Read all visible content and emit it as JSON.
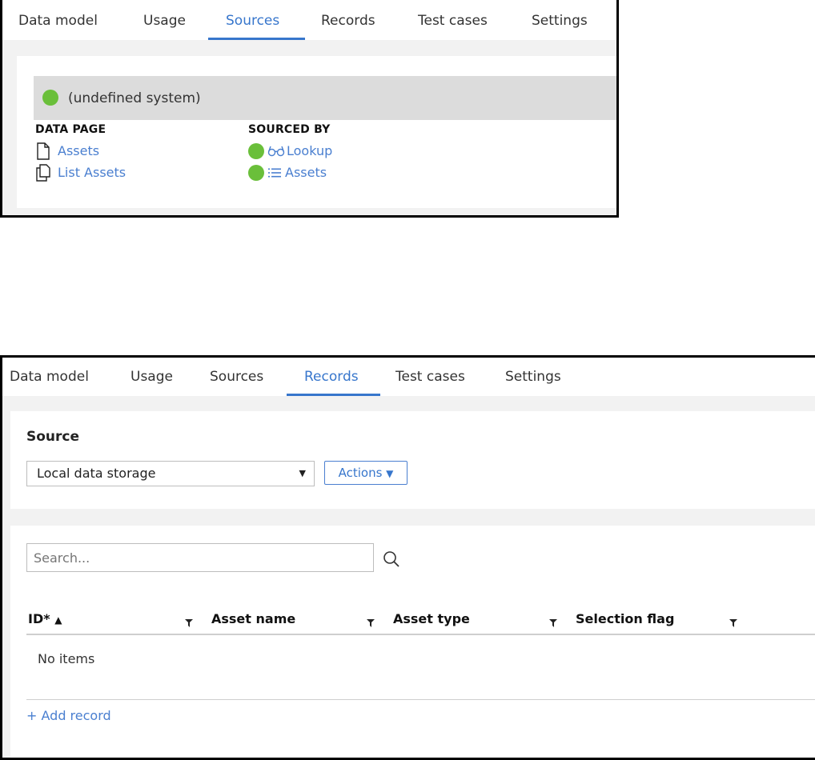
{
  "panel1": {
    "tabs": [
      {
        "label": "Data model"
      },
      {
        "label": "Usage"
      },
      {
        "label": "Sources",
        "active": true
      },
      {
        "label": "Records"
      },
      {
        "label": "Test cases"
      },
      {
        "label": "Settings"
      }
    ],
    "system_name": "(undefined system)",
    "data_page_heading": "DATA PAGE",
    "sourced_by_heading": "SOURCED BY",
    "data_pages": [
      {
        "label": "Assets",
        "icon": "document-icon"
      },
      {
        "label": "List Assets",
        "icon": "documents-icon"
      }
    ],
    "sourced_by": [
      {
        "label": "Lookup",
        "icon": "glasses-icon"
      },
      {
        "label": "Assets",
        "icon": "list-icon"
      }
    ]
  },
  "panel2": {
    "tabs": [
      {
        "label": "Data model"
      },
      {
        "label": "Usage"
      },
      {
        "label": "Sources"
      },
      {
        "label": "Records",
        "active": true
      },
      {
        "label": "Test cases"
      },
      {
        "label": "Settings"
      }
    ],
    "source_label": "Source",
    "source_value": "Local data storage",
    "actions_label": "Actions",
    "search_placeholder": "Search...",
    "columns": [
      {
        "label": "ID*",
        "sort": "ascending"
      },
      {
        "label": "Asset name"
      },
      {
        "label": "Asset type"
      },
      {
        "label": "Selection flag"
      }
    ],
    "empty_message": "No items",
    "add_record_label": "+ Add record"
  },
  "colors": {
    "accent": "#3776cc",
    "status_dot": "#6abf3a",
    "band": "#dcdcdc",
    "page_bg": "#f2f2f2"
  }
}
